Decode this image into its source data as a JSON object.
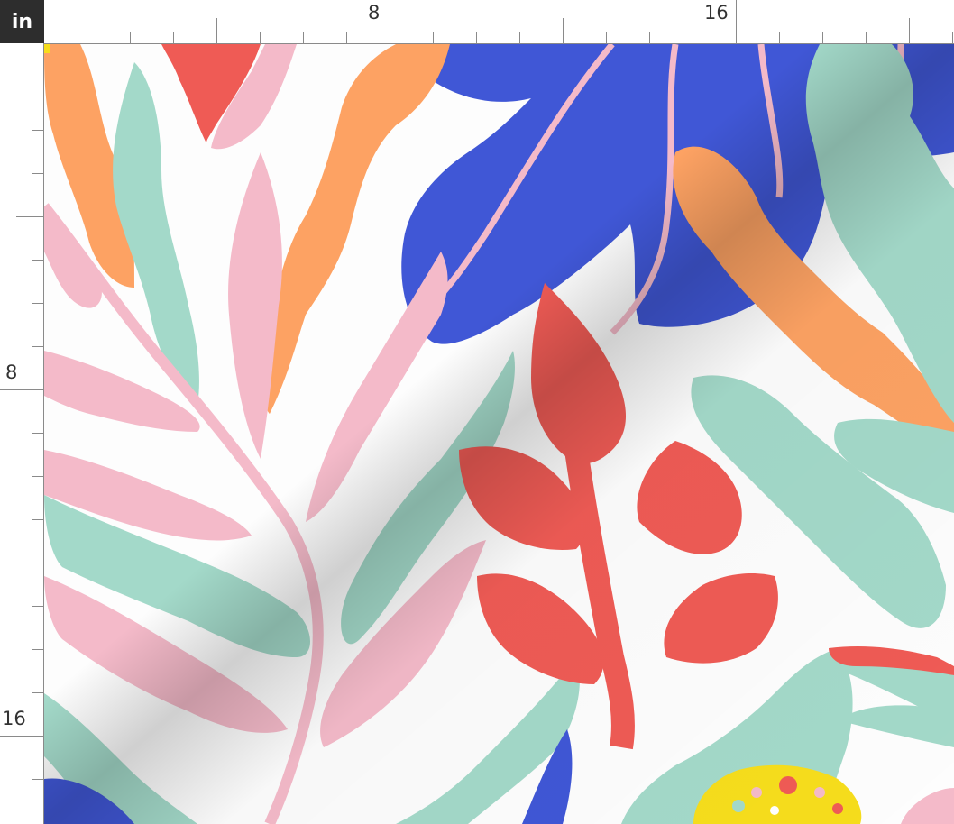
{
  "ruler": {
    "unit": "in",
    "top_labels": [
      "8",
      "16"
    ],
    "left_labels": [
      "8",
      "16"
    ]
  },
  "pattern": {
    "description_colors": {
      "blue": "#4057d6",
      "orange": "#fda263",
      "mint": "#a3d9c9",
      "pink": "#f4bac9",
      "red": "#ef5b55",
      "yellow": "#f6dd1c"
    }
  }
}
